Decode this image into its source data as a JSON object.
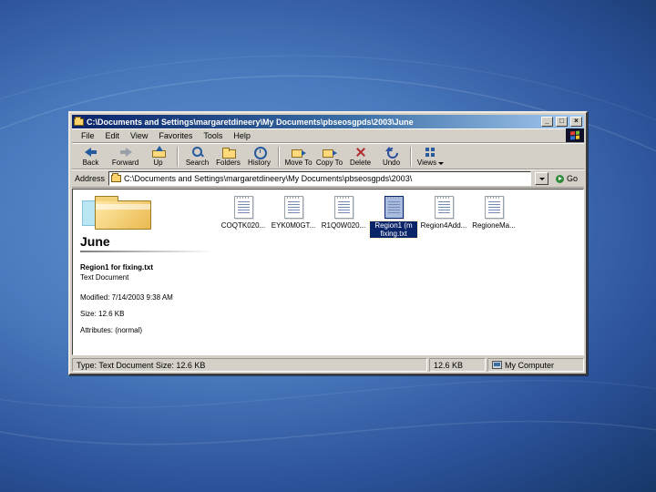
{
  "colors": {
    "titlebar_start": "#0a246a",
    "titlebar_end": "#a6caf0",
    "selection": "#0a246a",
    "chrome": "#d4d0c8",
    "slide_blue": "#4a7abd"
  },
  "window": {
    "title": "C:\\Documents and Settings\\margaretdineery\\My Documents\\pbseosgpds\\2003\\June",
    "controls": {
      "minimize": "_",
      "maximize": "□",
      "close": "×"
    }
  },
  "menu": {
    "items": [
      "File",
      "Edit",
      "View",
      "Favorites",
      "Tools",
      "Help"
    ]
  },
  "toolbar": {
    "buttons": [
      {
        "label": "Back"
      },
      {
        "label": "Forward"
      },
      {
        "label": "Up"
      },
      {
        "label": "Search"
      },
      {
        "label": "Folders"
      },
      {
        "label": "History"
      },
      {
        "label": "Move To"
      },
      {
        "label": "Copy To"
      },
      {
        "label": "Delete"
      },
      {
        "label": "Undo"
      },
      {
        "label": "Views"
      }
    ]
  },
  "address_bar": {
    "label": "Address",
    "value": "C:\\Documents and Settings\\margaretdineery\\My Documents\\pbseosgpds\\2003\\",
    "dropdown_glyph": "▼",
    "go_label": "Go"
  },
  "content": {
    "folder_name": "June",
    "selected_info": {
      "name": "Region1 for fixing.txt",
      "type": "Text Document",
      "modified": "Modified: 7/14/2003 9:38 AM",
      "size": "Size: 12.6 KB",
      "attributes": "Attributes: (normal)"
    },
    "files": [
      {
        "label": "COQTK020..."
      },
      {
        "label": "EYK0M0GT..."
      },
      {
        "label": "R1Q0W020..."
      },
      {
        "label": "Region1 (m fixing.txt"
      },
      {
        "label": "Region4Add..."
      },
      {
        "label": "RegioneMa..."
      }
    ]
  },
  "status_bar": {
    "left": "Type: Text Document Size: 12.6 KB",
    "middle": "12.6 KB",
    "right": "My Computer"
  }
}
